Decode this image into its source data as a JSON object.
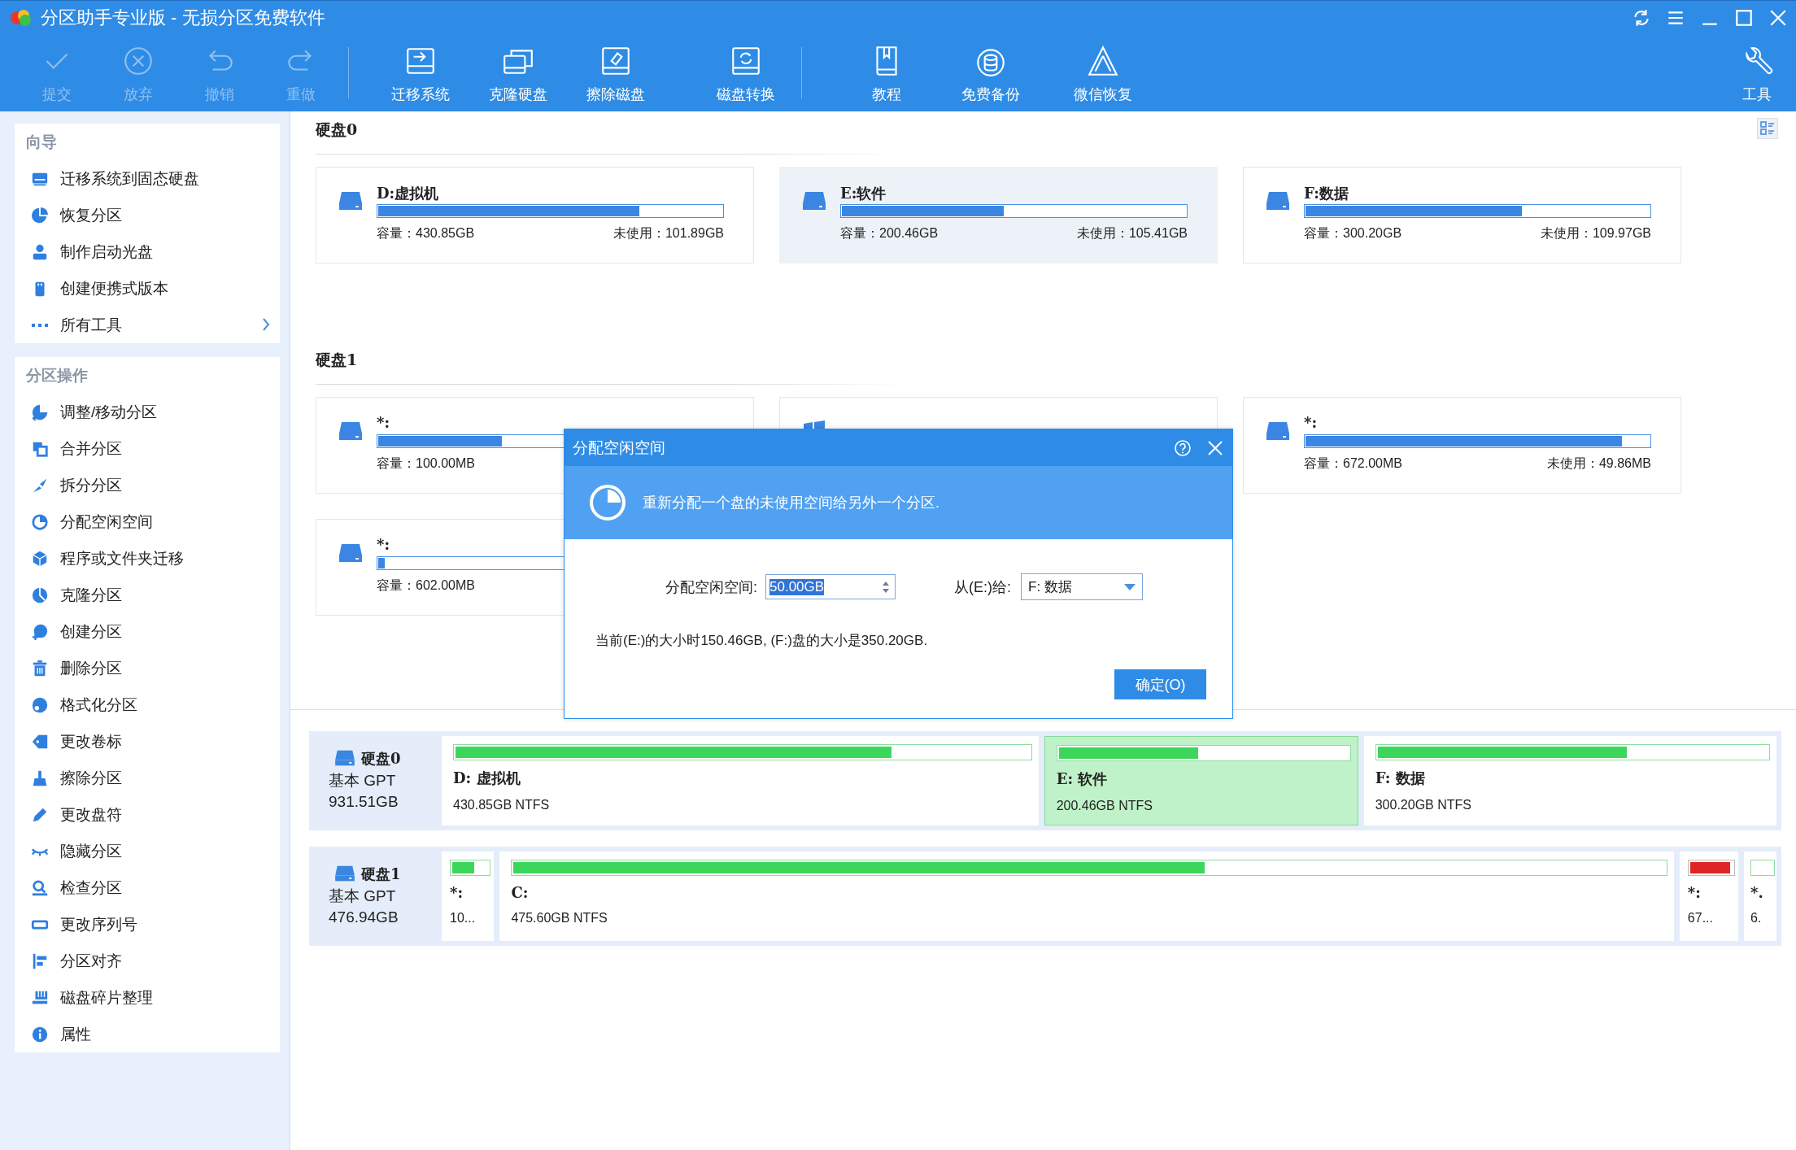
{
  "window": {
    "title": "分区助手专业版 - 无损分区免费软件"
  },
  "toolbar": {
    "buttons": [
      {
        "label": "提交",
        "disabled": true
      },
      {
        "label": "放弃",
        "disabled": true
      },
      {
        "label": "撤销",
        "disabled": true
      },
      {
        "label": "重做",
        "disabled": true
      },
      {
        "label": "迁移系统",
        "disabled": false
      },
      {
        "label": "克隆硬盘",
        "disabled": false
      },
      {
        "label": "擦除磁盘",
        "disabled": false
      },
      {
        "label": "磁盘转换",
        "disabled": false
      },
      {
        "label": "教程",
        "disabled": false
      },
      {
        "label": "免费备份",
        "disabled": false
      },
      {
        "label": "微信恢复",
        "disabled": false
      }
    ],
    "tools": "工具"
  },
  "sidebar": {
    "sections": [
      {
        "title": "向导",
        "items": [
          {
            "label": "迁移系统到固态硬盘",
            "has_submenu": false
          },
          {
            "label": "恢复分区",
            "has_submenu": false
          },
          {
            "label": "制作启动光盘",
            "has_submenu": false
          },
          {
            "label": "创建便携式版本",
            "has_submenu": false
          },
          {
            "label": "所有工具",
            "has_submenu": true
          }
        ]
      },
      {
        "title": "分区操作",
        "items": [
          {
            "label": "调整/移动分区",
            "has_submenu": false
          },
          {
            "label": "合并分区",
            "has_submenu": false
          },
          {
            "label": "拆分分区",
            "has_submenu": false
          },
          {
            "label": "分配空闲空间",
            "has_submenu": false
          },
          {
            "label": "程序或文件夹迁移",
            "has_submenu": false
          },
          {
            "label": "克隆分区",
            "has_submenu": false
          },
          {
            "label": "创建分区",
            "has_submenu": false
          },
          {
            "label": "删除分区",
            "has_submenu": false
          },
          {
            "label": "格式化分区",
            "has_submenu": false
          },
          {
            "label": "更改卷标",
            "has_submenu": false
          },
          {
            "label": "擦除分区",
            "has_submenu": false
          },
          {
            "label": "更改盘符",
            "has_submenu": false
          },
          {
            "label": "隐藏分区",
            "has_submenu": false
          },
          {
            "label": "检查分区",
            "has_submenu": false
          },
          {
            "label": "更改序列号",
            "has_submenu": false
          },
          {
            "label": "分区对齐",
            "has_submenu": false
          },
          {
            "label": "磁盘碎片整理",
            "has_submenu": false
          },
          {
            "label": "属性",
            "has_submenu": false
          }
        ]
      }
    ]
  },
  "disks": [
    {
      "title": "硬盘0",
      "partitions": [
        {
          "kind": "disk",
          "name": "D:虚拟机",
          "level": 0.76,
          "capacity": "容量：430.85GB",
          "free": "未使用：101.89GB",
          "selected": false
        },
        {
          "kind": "disk",
          "name": "E:软件",
          "level": 0.47,
          "capacity": "容量：200.46GB",
          "free": "未使用：105.41GB",
          "selected": true
        },
        {
          "kind": "disk",
          "name": "F:数据",
          "level": 0.63,
          "capacity": "容量：300.20GB",
          "free": "未使用：109.97GB",
          "selected": false
        }
      ]
    },
    {
      "title": "硬盘1",
      "partitions": [
        {
          "kind": "disk",
          "name": "*:",
          "level": 0.36,
          "capacity": "容量：100.00MB",
          "selected": false
        },
        {
          "kind": "windows",
          "selected": false
        },
        {
          "kind": "disk",
          "name": "*:",
          "level": 0.92,
          "capacity": "容量：672.00MB",
          "free": "未使用：49.86MB",
          "selected": false
        },
        {
          "kind": "disk",
          "name": "*:",
          "level": 0.02,
          "capacity": "容量：602.00MB",
          "selected": false
        }
      ]
    }
  ],
  "disk_map": [
    {
      "name": "硬盘0",
      "type": "基本 GPT",
      "size": "931.51GB",
      "partitions": [
        {
          "name": "D: 虚拟机",
          "info": "430.85GB NTFS",
          "level": 0.76,
          "color": "#3cd65a",
          "selected": false
        },
        {
          "name": "E: 软件",
          "info": "200.46GB NTFS",
          "level": 0.48,
          "color": "#3cd65a",
          "selected": true
        },
        {
          "name": "F: 数据",
          "info": "300.20GB NTFS",
          "level": 0.64,
          "color": "#3cd65a",
          "selected": false
        }
      ]
    },
    {
      "name": "硬盘1",
      "type": "基本 GPT",
      "size": "476.94GB",
      "partitions": [
        {
          "name": "*:",
          "info": "10...",
          "level": 0.6,
          "color": "#3cd65a",
          "selected": false
        },
        {
          "name": "C:",
          "info": "475.60GB NTFS",
          "level": 0.6,
          "color": "#3cd65a",
          "selected": false
        },
        {
          "name": "*:",
          "info": "67...",
          "level": 0.95,
          "color": "#e02424",
          "selected": false
        },
        {
          "name": "*.",
          "info": "6.",
          "selected": false
        }
      ]
    }
  ],
  "dialog": {
    "title": "分配空闲空间",
    "banner": "重新分配一个盘的未使用空间给另外一个分区.",
    "amount_label": "分配空闲空间:",
    "amount_value": "50.00GB",
    "from_label": "从(E:)给:",
    "target": "F: 数据",
    "info": "当前(E:)的大小时150.46GB, (F:)盘的大小是350.20GB.",
    "ok_button": "确定(O)"
  }
}
